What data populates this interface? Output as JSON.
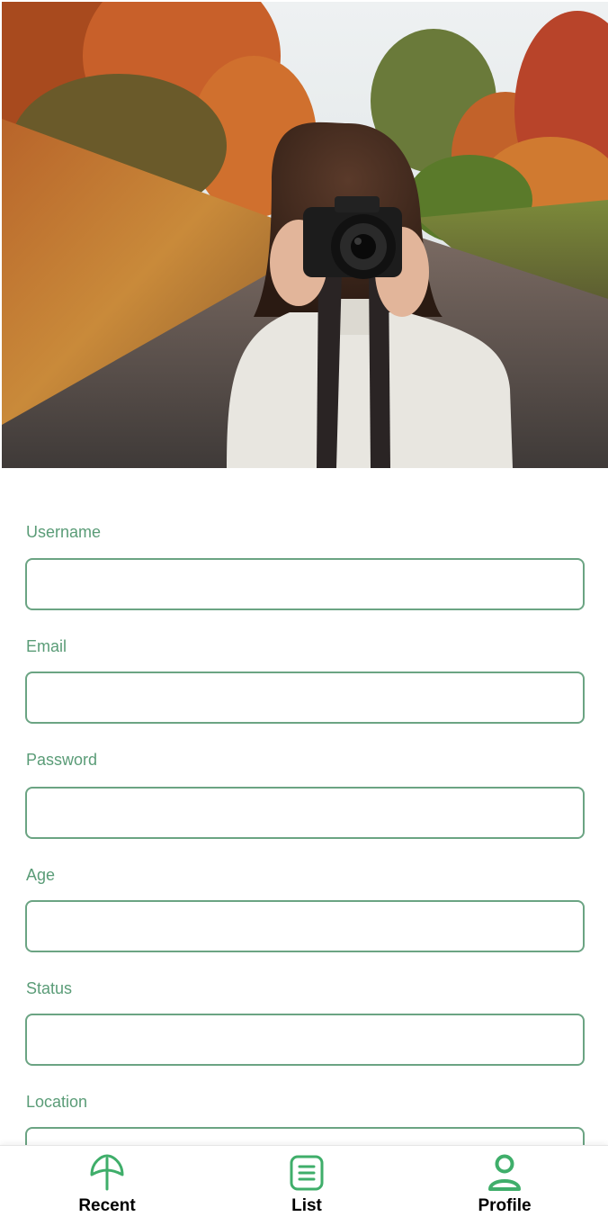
{
  "colors": {
    "accent": "#3fae6a",
    "label": "#5a9c77",
    "input_border": "#6ba483"
  },
  "header": {
    "hero_image": "woman-with-camera-photo",
    "top_right_icon": "profile-icon"
  },
  "form": {
    "fields": [
      {
        "label": "Username",
        "value": "",
        "placeholder": ""
      },
      {
        "label": "Email",
        "value": "",
        "placeholder": ""
      },
      {
        "label": "Password",
        "value": "",
        "placeholder": ""
      },
      {
        "label": "Age",
        "value": "",
        "placeholder": ""
      },
      {
        "label": "Status",
        "value": "",
        "placeholder": ""
      },
      {
        "label": "Location",
        "value": "",
        "placeholder": ""
      }
    ]
  },
  "bottom_nav": {
    "items": [
      {
        "label": "Recent",
        "icon": "leaf-icon"
      },
      {
        "label": "List",
        "icon": "list-icon"
      },
      {
        "label": "Profile",
        "icon": "profile-icon"
      }
    ]
  }
}
